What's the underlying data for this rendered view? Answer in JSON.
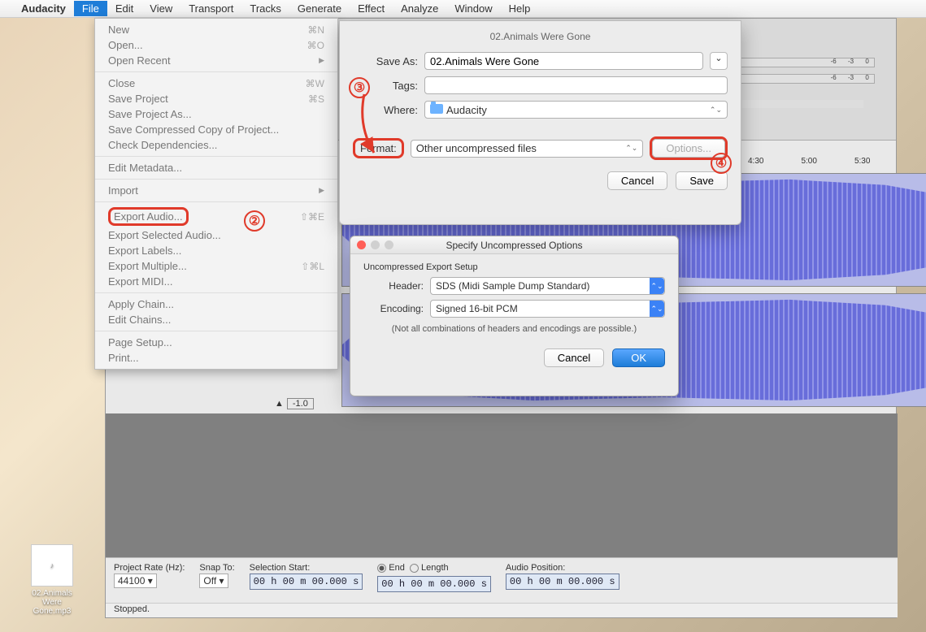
{
  "menubar": {
    "app": "Audacity",
    "items": [
      "File",
      "Edit",
      "View",
      "Transport",
      "Tracks",
      "Generate",
      "Effect",
      "Analyze",
      "Window",
      "Help"
    ],
    "active": "File"
  },
  "file_menu": {
    "g1": [
      {
        "l": "New",
        "s": "⌘N"
      },
      {
        "l": "Open...",
        "s": "⌘O"
      },
      {
        "l": "Open Recent",
        "arrow": true
      }
    ],
    "g2": [
      {
        "l": "Close",
        "s": "⌘W"
      },
      {
        "l": "Save Project",
        "s": "⌘S"
      },
      {
        "l": "Save Project As..."
      },
      {
        "l": "Save Compressed Copy of Project..."
      },
      {
        "l": "Check Dependencies..."
      }
    ],
    "g3": [
      {
        "l": "Edit Metadata..."
      }
    ],
    "g4": [
      {
        "l": "Import",
        "arrow": true
      }
    ],
    "g5": [
      {
        "l": "Export Audio...",
        "s": "⇧⌘E",
        "hl": true
      },
      {
        "l": "Export Selected Audio..."
      },
      {
        "l": "Export Labels..."
      },
      {
        "l": "Export Multiple...",
        "s": "⇧⌘L"
      },
      {
        "l": "Export MIDI..."
      }
    ],
    "g6": [
      {
        "l": "Apply Chain..."
      },
      {
        "l": "Edit Chains..."
      }
    ],
    "g7": [
      {
        "l": "Page Setup..."
      },
      {
        "l": "Print..."
      }
    ]
  },
  "export_sheet": {
    "title": "02.Animals Were Gone",
    "save_as_label": "Save As:",
    "save_as_value": "02.Animals Were Gone",
    "tags_label": "Tags:",
    "tags_value": "",
    "where_label": "Where:",
    "where_value": "Audacity",
    "format_label": "Format:",
    "format_value": "Other uncompressed files",
    "options_btn": "Options...",
    "cancel": "Cancel",
    "save": "Save"
  },
  "options_dialog": {
    "title": "Specify Uncompressed Options",
    "subtitle": "Uncompressed Export Setup",
    "header_label": "Header:",
    "header_value": "SDS (Midi Sample Dump Standard)",
    "encoding_label": "Encoding:",
    "encoding_value": "Signed 16-bit PCM",
    "note": "(Not all combinations of headers and encodings are possible.)",
    "cancel": "Cancel",
    "ok": "OK"
  },
  "meters": {
    "marks": [
      "-6",
      "-3",
      "0"
    ]
  },
  "timeline": [
    "4:30",
    "5:00",
    "5:30"
  ],
  "track_ruler": {
    "amp": "-1.0"
  },
  "bottom": {
    "project_rate_label": "Project Rate (Hz):",
    "project_rate": "44100",
    "snap_label": "Snap To:",
    "snap": "Off",
    "sel_start_label": "Selection Start:",
    "sel_start": "00 h 00 m 00.000 s",
    "end_label": "End",
    "length_label": "Length",
    "sel_end": "00 h 00 m 00.000 s",
    "audio_pos_label": "Audio Position:",
    "audio_pos": "00 h 00 m 00.000 s"
  },
  "status": "Stopped.",
  "desktop_file": "02.Animals Were Gone.mp3",
  "callouts": {
    "c2": "②",
    "c3": "③",
    "c4": "④"
  }
}
